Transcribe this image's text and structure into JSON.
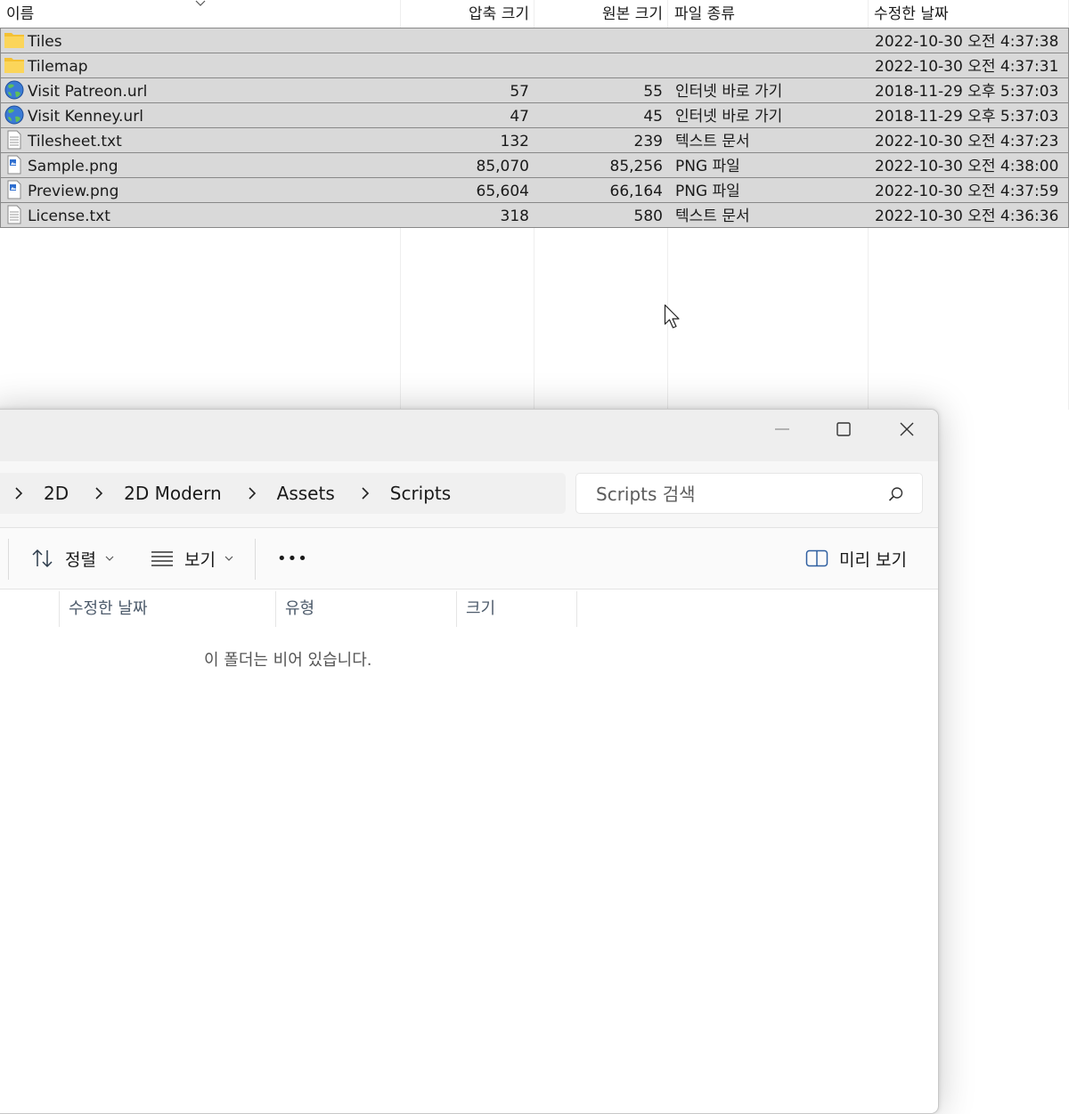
{
  "archive": {
    "columns": {
      "name": "이름",
      "compressed": "압축 크기",
      "original": "원본 크기",
      "type": "파일 종류",
      "modified": "수정한 날짜"
    },
    "rows": [
      {
        "icon": "folder-icon",
        "name": "Tiles",
        "compressed": "",
        "original": "",
        "type": "",
        "modified": "2022-10-30 오전 4:37:38"
      },
      {
        "icon": "folder-icon",
        "name": "Tilemap",
        "compressed": "",
        "original": "",
        "type": "",
        "modified": "2022-10-30 오전 4:37:31"
      },
      {
        "icon": "globe-icon",
        "name": "Visit Patreon.url",
        "compressed": "57",
        "original": "55",
        "type": "인터넷 바로 가기",
        "modified": "2018-11-29 오후 5:37:03"
      },
      {
        "icon": "globe-icon",
        "name": "Visit Kenney.url",
        "compressed": "47",
        "original": "45",
        "type": "인터넷 바로 가기",
        "modified": "2018-11-29 오후 5:37:03"
      },
      {
        "icon": "text-file-icon",
        "name": "Tilesheet.txt",
        "compressed": "132",
        "original": "239",
        "type": "텍스트 문서",
        "modified": "2022-10-30 오전 4:37:23"
      },
      {
        "icon": "image-file-icon",
        "name": "Sample.png",
        "compressed": "85,070",
        "original": "85,256",
        "type": "PNG 파일",
        "modified": "2022-10-30 오전 4:38:00"
      },
      {
        "icon": "image-file-icon",
        "name": "Preview.png",
        "compressed": "65,604",
        "original": "66,164",
        "type": "PNG 파일",
        "modified": "2022-10-30 오전 4:37:59"
      },
      {
        "icon": "text-file-icon",
        "name": "License.txt",
        "compressed": "318",
        "original": "580",
        "type": "텍스트 문서",
        "modified": "2022-10-30 오전 4:36:36"
      }
    ]
  },
  "explorer": {
    "breadcrumb": [
      "2D",
      "2D Modern",
      "Assets",
      "Scripts"
    ],
    "search_placeholder": "Scripts 검색",
    "toolbar": {
      "sort_label": "정렬",
      "view_label": "보기",
      "more_label": "•••",
      "preview_label": "미리 보기"
    },
    "columns": [
      "수정한 날짜",
      "유형",
      "크기"
    ],
    "empty_message": "이 폴더는 비어 있습니다."
  }
}
